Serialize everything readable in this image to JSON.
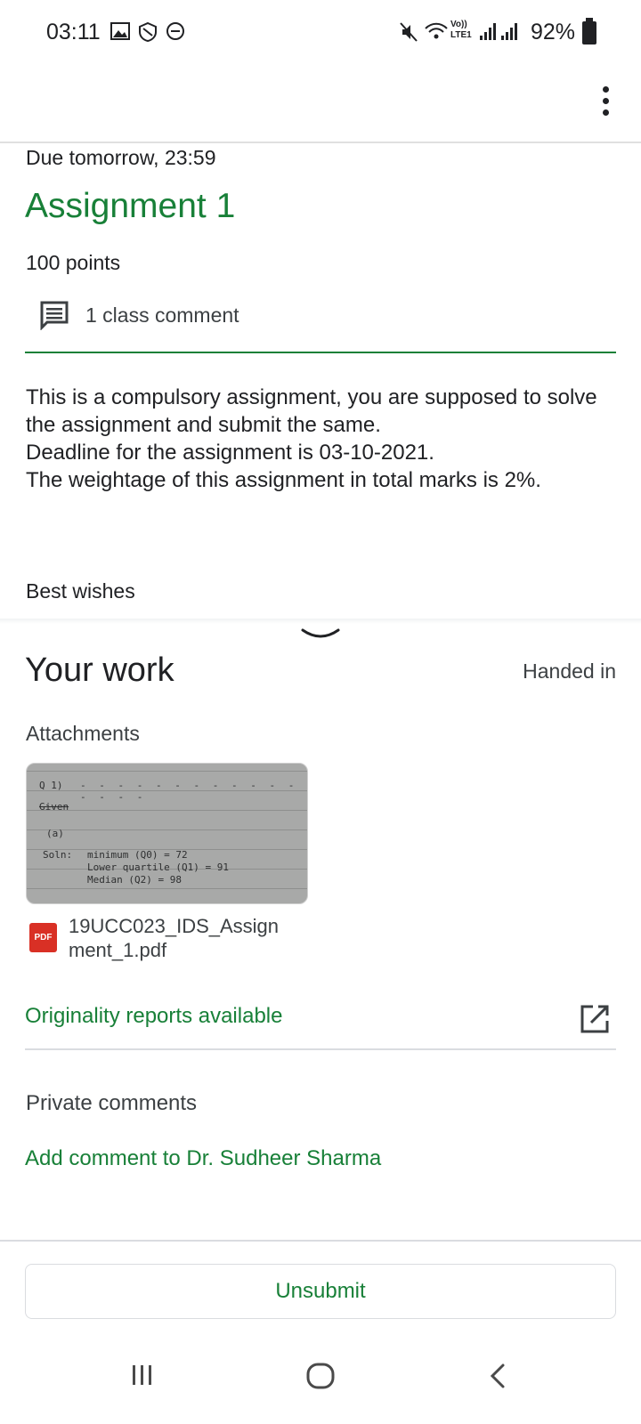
{
  "status_bar": {
    "time": "03:11",
    "network_label": "Vo)) LTE1",
    "battery_text": "92%",
    "left_icons": [
      "gallery-icon",
      "vpn-icon",
      "do-not-disturb-icon"
    ],
    "right_icons": [
      "mute-icon",
      "wifi-icon",
      "signal-icon",
      "signal-roaming-icon",
      "battery-icon"
    ]
  },
  "app_bar": {
    "menu_icon": "more-vert-icon"
  },
  "assignment": {
    "due": "Due tomorrow, 23:59",
    "title": "Assignment 1",
    "points": "100 points",
    "comments": "1 class comment",
    "description": "This is a compulsory assignment, you are supposed to solve the assignment and submit the same.\nDeadline for the assignment is 03-10-2021.\nThe weightage of this assignment in total marks is 2%.",
    "closing": "Best wishes"
  },
  "your_work": {
    "title": "Your work",
    "status": "Handed in",
    "attachments_label": "Attachments",
    "thumbnail_text": {
      "q": "Q 1)",
      "given": "Given",
      "part": "(a)",
      "soln": "Soln:",
      "line1": "minimum (Q0) = 72",
      "line2": "Lower quartile (Q1) = 91",
      "line3": "Median (Q2) = 98"
    },
    "file": {
      "type_badge": "PDF",
      "name": "19UCC023_IDS_Assignment_1.pdf"
    },
    "originality": "Originality reports available",
    "private_comments_label": "Private comments",
    "add_comment": "Add comment to Dr. Sudheer Sharma",
    "unsubmit": "Unsubmit"
  },
  "nav_bar": {
    "buttons": [
      "recent-apps-icon",
      "home-icon",
      "back-icon"
    ]
  },
  "colors": {
    "accent_green": "#188038",
    "pdf_red": "#d93025",
    "divider": "#dadce0"
  }
}
